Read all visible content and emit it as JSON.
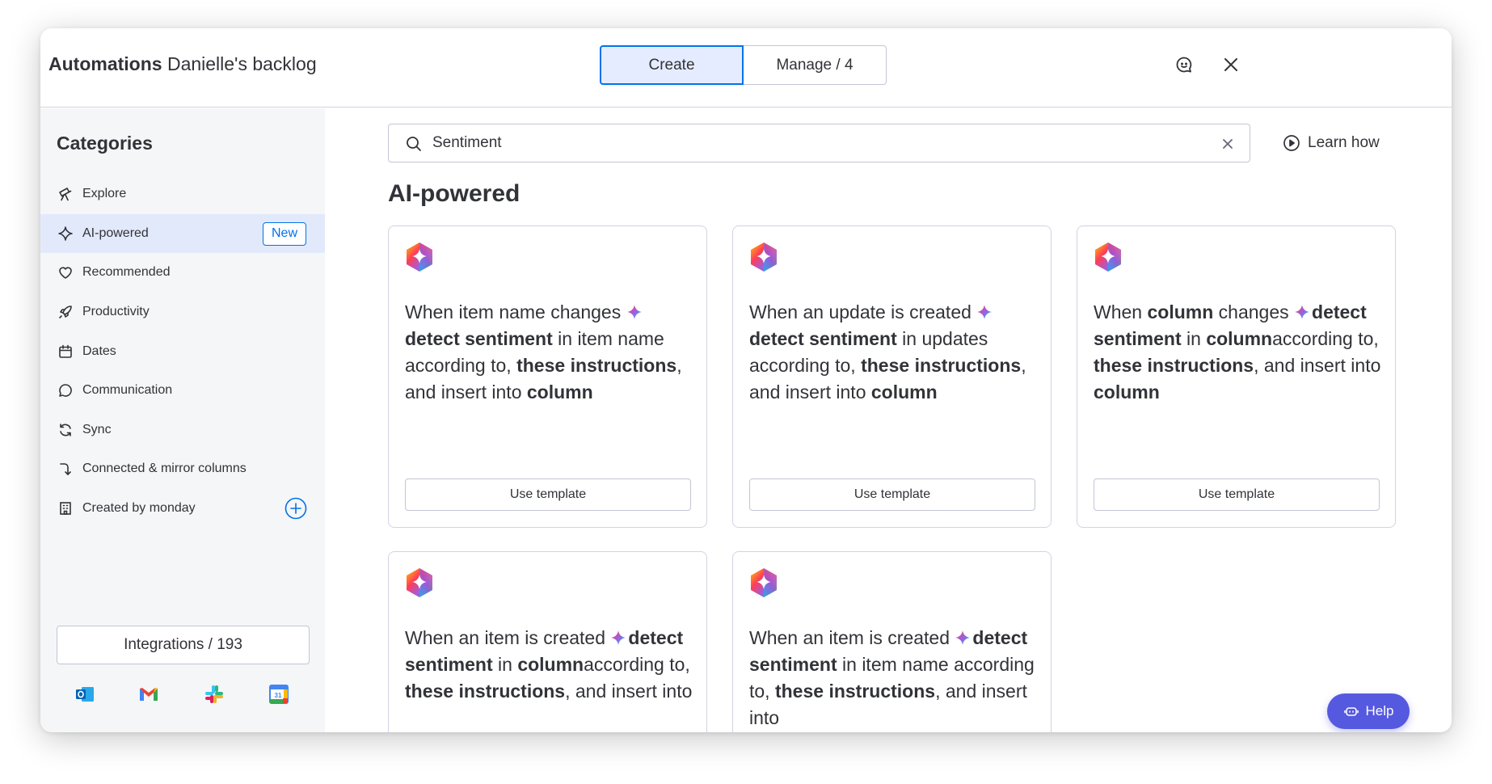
{
  "header": {
    "title_bold": "Automations",
    "title_board": "Danielle's backlog",
    "tabs": [
      {
        "label": "Create",
        "active": true
      },
      {
        "label": "Manage / 4",
        "active": false
      }
    ],
    "icons": [
      "feedback-icon",
      "close-icon"
    ]
  },
  "sidebar": {
    "title": "Categories",
    "items": [
      {
        "label": "Explore",
        "icon": "telescope-icon"
      },
      {
        "label": "AI-powered",
        "icon": "sparkle-icon",
        "badge": "New",
        "active": true
      },
      {
        "label": "Recommended",
        "icon": "heart-icon"
      },
      {
        "label": "Productivity",
        "icon": "rocket-icon"
      },
      {
        "label": "Dates",
        "icon": "calendar-icon"
      },
      {
        "label": "Communication",
        "icon": "chat-icon"
      },
      {
        "label": "Sync",
        "icon": "sync-icon"
      },
      {
        "label": "Connected & mirror columns",
        "icon": "connect-icon"
      },
      {
        "label": "Created by monday",
        "icon": "building-icon"
      }
    ],
    "integrations_label": "Integrations / 193",
    "apps": [
      "outlook-icon",
      "gmail-icon",
      "slack-icon",
      "google-calendar-icon"
    ]
  },
  "search": {
    "value": "Sentiment"
  },
  "learn_how": "Learn how",
  "section_title": "AI-powered",
  "cards": [
    {
      "parts": [
        {
          "t": "When item name changes ",
          "b": false
        },
        {
          "t": "detect sentiment",
          "b": true,
          "spark": true
        },
        {
          "t": " in item name according to, ",
          "b": false
        },
        {
          "t": "these instructions",
          "b": true
        },
        {
          "t": ", and insert into ",
          "b": false
        },
        {
          "t": "column",
          "b": true
        }
      ],
      "button": "Use template"
    },
    {
      "parts": [
        {
          "t": "When an update is created ",
          "b": false
        },
        {
          "t": "detect sentiment",
          "b": true,
          "spark": true
        },
        {
          "t": " in updates according to, ",
          "b": false
        },
        {
          "t": "these instructions",
          "b": true
        },
        {
          "t": ", and insert into ",
          "b": false
        },
        {
          "t": "column",
          "b": true
        }
      ],
      "button": "Use template"
    },
    {
      "parts": [
        {
          "t": "When ",
          "b": false
        },
        {
          "t": "column",
          "b": true
        },
        {
          "t": " changes ",
          "b": false
        },
        {
          "t": "detect sentiment",
          "b": true,
          "spark": true
        },
        {
          "t": " in ",
          "b": false
        },
        {
          "t": "column",
          "b": true
        },
        {
          "t": "according to, ",
          "b": false
        },
        {
          "t": "these instructions",
          "b": true
        },
        {
          "t": ", and insert into ",
          "b": false
        },
        {
          "t": "column",
          "b": true
        }
      ],
      "button": "Use template"
    },
    {
      "parts": [
        {
          "t": "When an item is created ",
          "b": false
        },
        {
          "t": "detect sentiment",
          "b": true,
          "spark": true
        },
        {
          "t": " in ",
          "b": false
        },
        {
          "t": "column",
          "b": true
        },
        {
          "t": "according to, ",
          "b": false
        },
        {
          "t": "these instructions",
          "b": true
        },
        {
          "t": ", and insert into",
          "b": false
        }
      ],
      "button": ""
    },
    {
      "parts": [
        {
          "t": "When an item is created ",
          "b": false
        },
        {
          "t": "detect sentiment",
          "b": true,
          "spark": true
        },
        {
          "t": " in item name according to, ",
          "b": false
        },
        {
          "t": "these instructions",
          "b": true
        },
        {
          "t": ", and insert into",
          "b": false
        }
      ],
      "button": ""
    }
  ],
  "help_label": "Help",
  "colors": {
    "primary": "#0073ea",
    "active_bg": "#e5ecff",
    "sidebar_bg": "#f5f6f8",
    "help_bg": "#5559df",
    "text": "#323338"
  }
}
